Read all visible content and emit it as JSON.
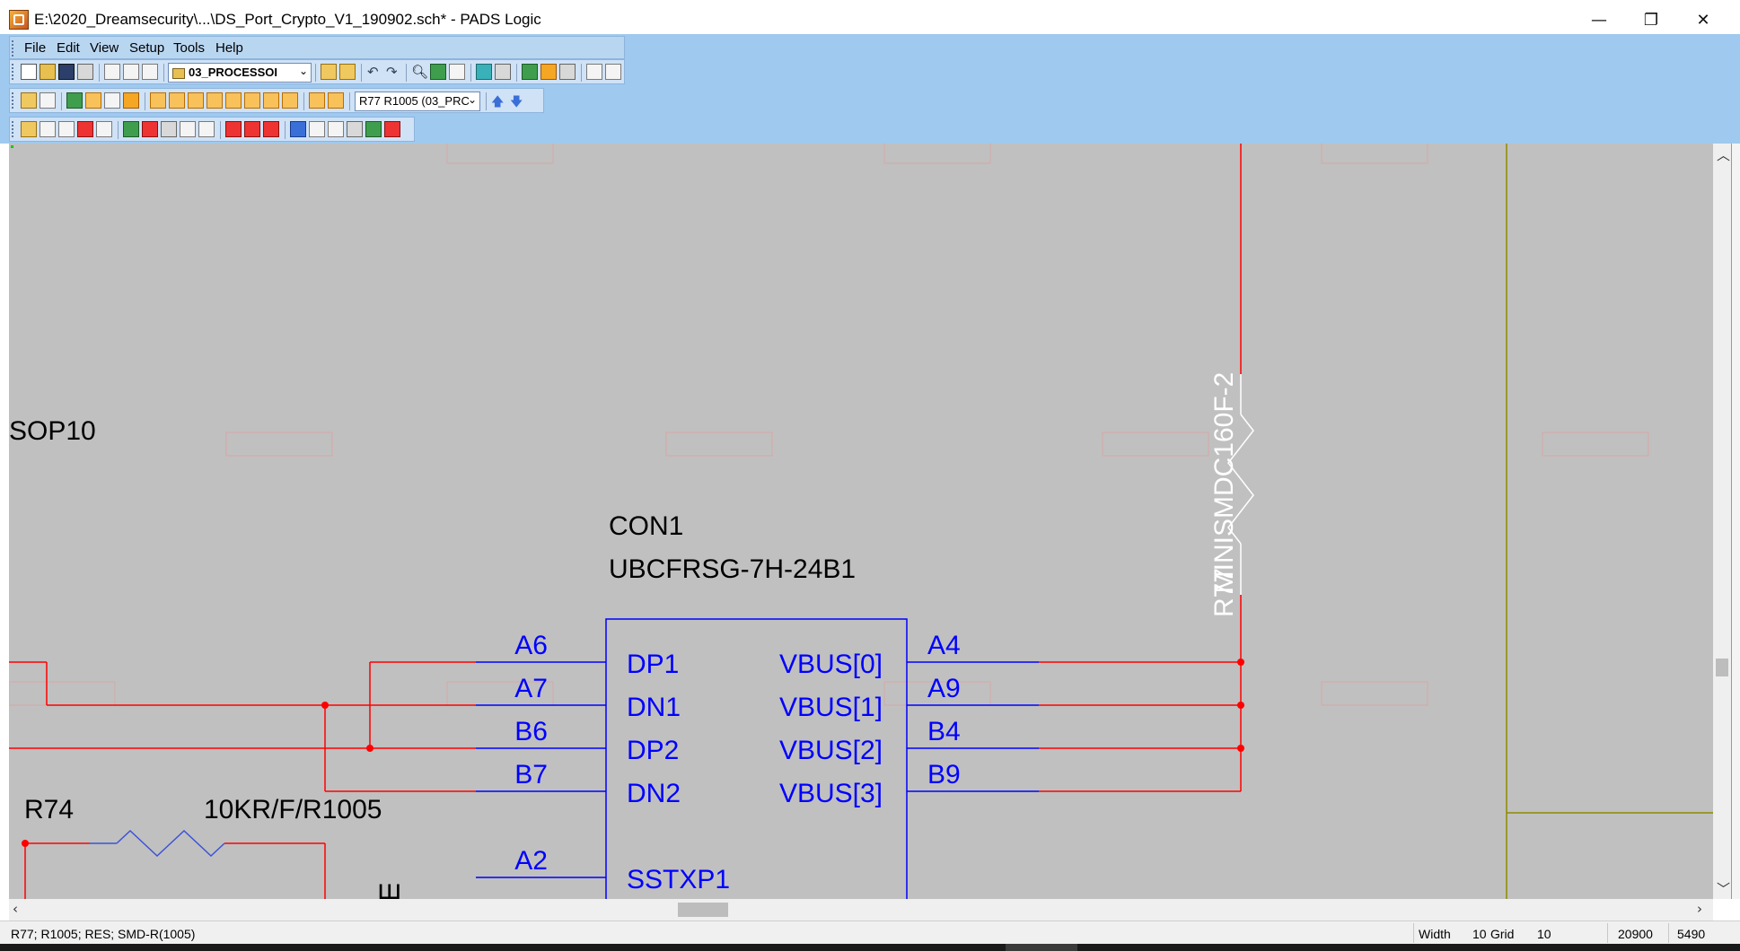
{
  "window": {
    "title": "E:\\2020_Dreamsecurity\\...\\DS_Port_Crypto_V1_190902.sch* - PADS Logic",
    "minimize": "—",
    "restore": "❐",
    "close": "✕"
  },
  "menu": [
    "File",
    "Edit",
    "View",
    "Setup",
    "Tools",
    "Help"
  ],
  "toolbar": {
    "sheet_select": "03_PROCESSOI",
    "part_select": "R77 R1005 (03_PRC"
  },
  "schematic": {
    "labels": {
      "sop10": "SOP10",
      "con1_ref": "CON1",
      "con1_part": "UBCFRSG-7H-24B1",
      "r74_ref": "R74",
      "r74_value": "10KR/F/R1005",
      "r77_ref": "R77",
      "r77_value": "MINISMDC160F-2",
      "partial": "ꟺ"
    },
    "pins_left": [
      {
        "pin": "A6",
        "name": "DP1"
      },
      {
        "pin": "A7",
        "name": "DN1"
      },
      {
        "pin": "B6",
        "name": "DP2"
      },
      {
        "pin": "B7",
        "name": "DN2"
      },
      {
        "pin": "A2",
        "name": "SSTXP1"
      }
    ],
    "pins_right": [
      {
        "pin": "A4",
        "name": "VBUS[0]"
      },
      {
        "pin": "A9",
        "name": "VBUS[1]"
      },
      {
        "pin": "B4",
        "name": "VBUS[2]"
      },
      {
        "pin": "B9",
        "name": "VBUS[3]"
      }
    ],
    "colors": {
      "background": "#c0c0c0",
      "net": "#ff0000",
      "pin": "#0000ff",
      "label": "#000000",
      "border": "#8c8c00",
      "watermark": "#e87a7a"
    }
  },
  "status": {
    "selection": "R77; R1005; RES; SMD-R(1005)",
    "width_label": "Width",
    "width_value": "10",
    "grid_label": "Grid",
    "grid_value": "10",
    "x": "20900",
    "y": "5490"
  }
}
